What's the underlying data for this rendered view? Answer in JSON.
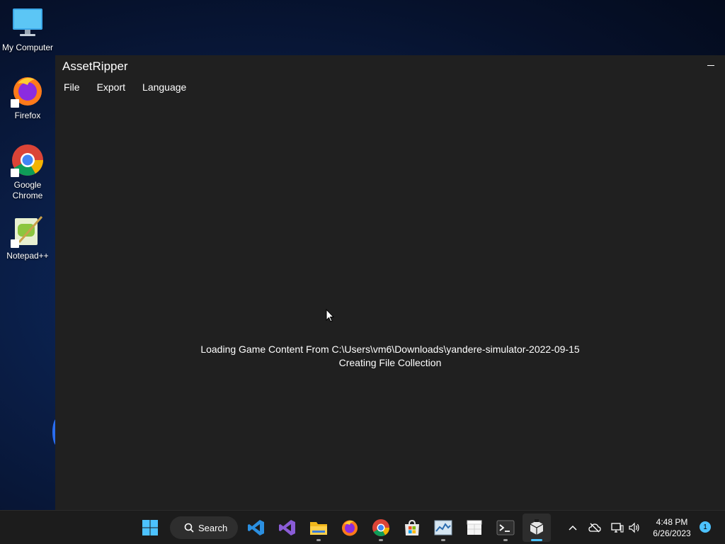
{
  "desktop": {
    "icons": [
      {
        "label": "My Computer",
        "icon": "monitor-icon"
      },
      {
        "label": "Firefox",
        "icon": "firefox-icon"
      },
      {
        "label": "Google Chrome",
        "icon": "chrome-icon"
      },
      {
        "label": "Notepad++",
        "icon": "notepadpp-icon"
      }
    ]
  },
  "window": {
    "title": "AssetRipper",
    "menu": [
      "File",
      "Export",
      "Language"
    ],
    "status_line1": "Loading Game Content From C:\\Users\\vm6\\Downloads\\yandere-simulator-2022-09-15",
    "status_line2": "Creating File Collection"
  },
  "taskbar": {
    "search_label": "Search",
    "apps": [
      "start-icon",
      "vscode-icon",
      "visual-studio-icon",
      "file-explorer-icon",
      "firefox-icon",
      "chrome-icon",
      "store-icon",
      "task-manager-icon",
      "snipping-icon",
      "terminal-icon",
      "assetripper-icon"
    ],
    "clock_time": "4:48 PM",
    "clock_date": "6/26/2023",
    "notification_count": "1"
  },
  "colors": {
    "window_bg": "#202020",
    "taskbar_bg": "#1c1c1c",
    "accent": "#4cc2ff"
  }
}
